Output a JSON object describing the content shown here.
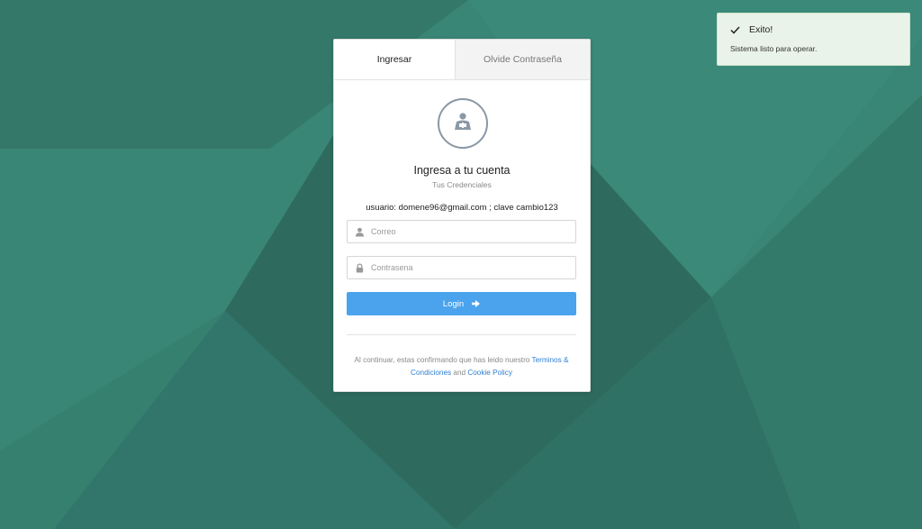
{
  "colors": {
    "background": "#3a8676",
    "accent": "#4aa3ec",
    "link": "#2f7fd1",
    "toast_background": "#e9f3e9"
  },
  "tabs": [
    {
      "label": "Ingresar",
      "active": true
    },
    {
      "label": "Olvide Contraseña",
      "active": false
    }
  ],
  "login": {
    "avatar_icon": "user-box-icon",
    "title": "Ingresa a tu cuenta",
    "subtitle": "Tus Credenciales",
    "hint": "usuario: domene96@gmail.com ; clave cambio123",
    "email": {
      "placeholder": "Correo",
      "value": "",
      "icon": "user-icon"
    },
    "password": {
      "placeholder": "Contrasena",
      "value": "",
      "icon": "lock-icon"
    },
    "button_label": "Login",
    "button_icon": "arrow-right-icon"
  },
  "terms": {
    "prefix": "Al continuar, estas confirmando que has leido nuestro ",
    "link1": "Terminos & Condiciones",
    "middle": " and ",
    "link2": "Cookie Policy"
  },
  "toast": {
    "icon": "check-icon",
    "title": "Exito!",
    "message": "Sistema listo para operar."
  }
}
